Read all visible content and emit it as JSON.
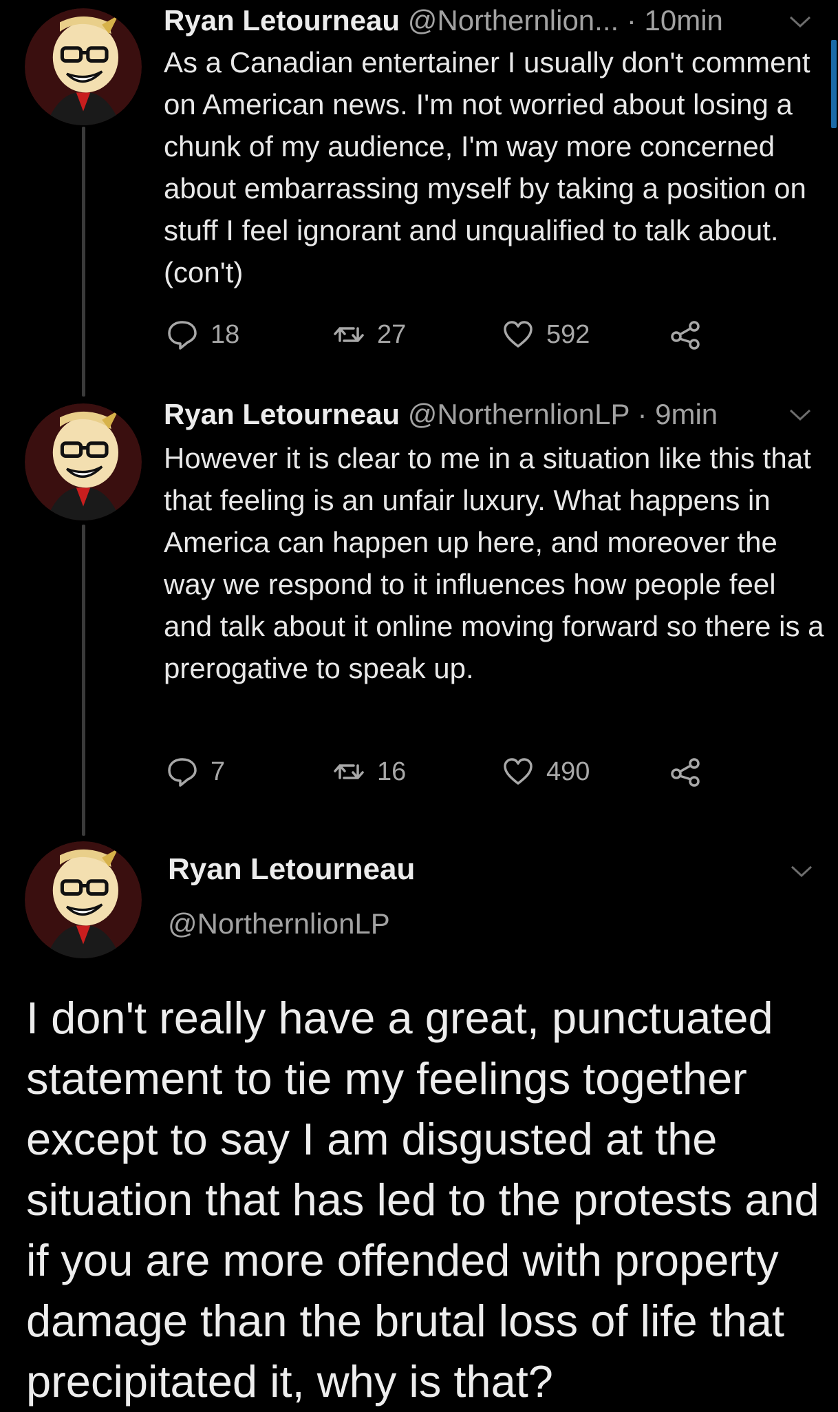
{
  "tweets": [
    {
      "name": "Ryan Letourneau",
      "handle": "@Northernlion...",
      "time": " · 10min",
      "text": "As a Canadian entertainer I usually don't comment on American news. I'm not worried about losing a chunk of my audience, I'm way more concerned about embarrassing myself by taking a position on stuff I feel ignorant and unqualified to talk about. (con't)",
      "replies": "18",
      "retweets": "27",
      "likes": "592"
    },
    {
      "name": "Ryan Letourneau",
      "handle": "@NorthernlionLP",
      "time": " · 9min",
      "text": "However it is clear to me in a situation like this that that feeling is an unfair luxury. What happens in America can happen up here, and moreover the way we respond to it influences how people feel and talk about it online moving forward so there is a prerogative to speak up.",
      "replies": "7",
      "retweets": "16",
      "likes": "490"
    }
  ],
  "main_tweet": {
    "name": "Ryan Letourneau",
    "handle": "@NorthernlionLP",
    "text": "I don't really have a great, punctuated statement to tie my feelings together except to say I am disgusted at the situation that has led to the protests and if you are more offended with property damage than the brutal loss of life that precipitated it, why is that?"
  },
  "icons": {
    "reply": "reply-icon",
    "retweet": "retweet-icon",
    "like": "heart-icon",
    "share": "share-icon",
    "menu": "chevron-down-icon"
  },
  "colors": {
    "background": "#000000",
    "text": "#e8e8e8",
    "secondary": "#a2a2a2",
    "accent": "#1b6aa8"
  }
}
